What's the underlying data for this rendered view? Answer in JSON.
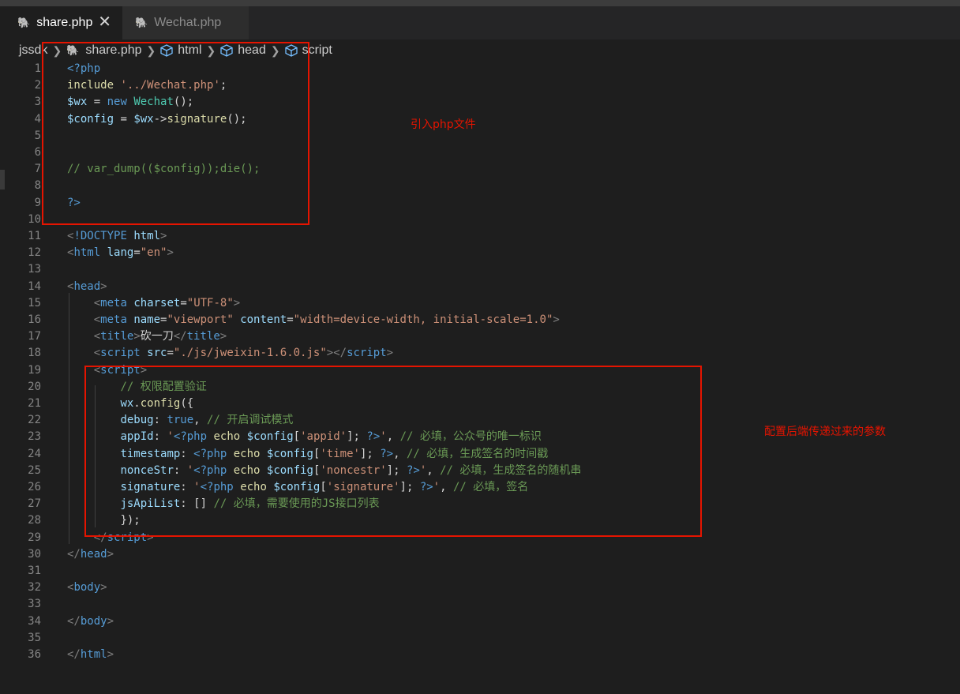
{
  "tabs": [
    {
      "label": "share.php",
      "active": true,
      "close": "✕"
    },
    {
      "label": "Wechat.php",
      "active": false
    }
  ],
  "breadcrumb": {
    "folder": "jssdk",
    "file": "share.php",
    "items": [
      "html",
      "head",
      "script"
    ]
  },
  "lines": [
    {
      "n": "1",
      "tokens": [
        [
          "tag",
          "<?php"
        ]
      ]
    },
    {
      "n": "2",
      "tokens": [
        [
          "fn",
          "include"
        ],
        [
          "ident",
          " "
        ],
        [
          "str",
          "'../Wechat.php'"
        ],
        [
          "ident",
          ";"
        ]
      ]
    },
    {
      "n": "3",
      "tokens": [
        [
          "var",
          "$wx"
        ],
        [
          "ident",
          " = "
        ],
        [
          "kw",
          "new"
        ],
        [
          "ident",
          " "
        ],
        [
          "cls",
          "Wechat"
        ],
        [
          "ident",
          "();"
        ]
      ]
    },
    {
      "n": "4",
      "tokens": [
        [
          "var",
          "$config"
        ],
        [
          "ident",
          " = "
        ],
        [
          "var",
          "$wx"
        ],
        [
          "ident",
          "->"
        ],
        [
          "fn",
          "signature"
        ],
        [
          "ident",
          "();"
        ]
      ]
    },
    {
      "n": "5",
      "tokens": []
    },
    {
      "n": "6",
      "tokens": []
    },
    {
      "n": "7",
      "tokens": [
        [
          "cm",
          "// var_dump(($config));die();"
        ]
      ]
    },
    {
      "n": "8",
      "tokens": []
    },
    {
      "n": "9",
      "tokens": [
        [
          "tag",
          "?>"
        ]
      ]
    },
    {
      "n": "10",
      "tokens": []
    },
    {
      "n": "11",
      "tokens": [
        [
          "punct",
          "<"
        ],
        [
          "tag",
          "!DOCTYPE"
        ],
        [
          "ident",
          " "
        ],
        [
          "var",
          "html"
        ],
        [
          "punct",
          ">"
        ]
      ]
    },
    {
      "n": "12",
      "tokens": [
        [
          "punct",
          "<"
        ],
        [
          "tag",
          "html"
        ],
        [
          "ident",
          " "
        ],
        [
          "var",
          "lang"
        ],
        [
          "ident",
          "="
        ],
        [
          "str",
          "\"en\""
        ],
        [
          "punct",
          ">"
        ]
      ]
    },
    {
      "n": "13",
      "tokens": []
    },
    {
      "n": "14",
      "tokens": [
        [
          "punct",
          "<"
        ],
        [
          "tag",
          "head"
        ],
        [
          "punct",
          ">"
        ]
      ]
    },
    {
      "n": "15",
      "tokens": [
        [
          "ident",
          "    "
        ],
        [
          "punct",
          "<"
        ],
        [
          "tag",
          "meta"
        ],
        [
          "ident",
          " "
        ],
        [
          "var",
          "charset"
        ],
        [
          "ident",
          "="
        ],
        [
          "str",
          "\"UTF-8\""
        ],
        [
          "punct",
          ">"
        ]
      ]
    },
    {
      "n": "16",
      "tokens": [
        [
          "ident",
          "    "
        ],
        [
          "punct",
          "<"
        ],
        [
          "tag",
          "meta"
        ],
        [
          "ident",
          " "
        ],
        [
          "var",
          "name"
        ],
        [
          "ident",
          "="
        ],
        [
          "str",
          "\"viewport\""
        ],
        [
          "ident",
          " "
        ],
        [
          "var",
          "content"
        ],
        [
          "ident",
          "="
        ],
        [
          "str",
          "\"width=device-width, initial-scale=1.0\""
        ],
        [
          "punct",
          ">"
        ]
      ]
    },
    {
      "n": "17",
      "tokens": [
        [
          "ident",
          "    "
        ],
        [
          "punct",
          "<"
        ],
        [
          "tag",
          "title"
        ],
        [
          "punct",
          ">"
        ],
        [
          "ident",
          "砍一刀"
        ],
        [
          "punct",
          "</"
        ],
        [
          "tag",
          "title"
        ],
        [
          "punct",
          ">"
        ]
      ]
    },
    {
      "n": "18",
      "tokens": [
        [
          "ident",
          "    "
        ],
        [
          "punct",
          "<"
        ],
        [
          "tag",
          "script"
        ],
        [
          "ident",
          " "
        ],
        [
          "var",
          "src"
        ],
        [
          "ident",
          "="
        ],
        [
          "str",
          "\"./js/jweixin-1.6.0.js\""
        ],
        [
          "punct",
          "></"
        ],
        [
          "tag",
          "script"
        ],
        [
          "punct",
          ">"
        ]
      ]
    },
    {
      "n": "19",
      "tokens": [
        [
          "ident",
          "    "
        ],
        [
          "punct",
          "<"
        ],
        [
          "tag",
          "script"
        ],
        [
          "punct",
          ">"
        ]
      ]
    },
    {
      "n": "20",
      "tokens": [
        [
          "ident",
          "        "
        ],
        [
          "cm",
          "// 权限配置验证"
        ]
      ]
    },
    {
      "n": "21",
      "tokens": [
        [
          "ident",
          "        "
        ],
        [
          "var",
          "wx"
        ],
        [
          "ident",
          "."
        ],
        [
          "fn",
          "config"
        ],
        [
          "ident",
          "({"
        ]
      ]
    },
    {
      "n": "22",
      "tokens": [
        [
          "ident",
          "        "
        ],
        [
          "var",
          "debug"
        ],
        [
          "ident",
          ": "
        ],
        [
          "kw",
          "true"
        ],
        [
          "ident",
          ", "
        ],
        [
          "cm",
          "// 开启调试模式"
        ]
      ]
    },
    {
      "n": "23",
      "tokens": [
        [
          "ident",
          "        "
        ],
        [
          "var",
          "appId"
        ],
        [
          "ident",
          ": "
        ],
        [
          "str",
          "'"
        ],
        [
          "tag",
          "<?php"
        ],
        [
          "ident",
          " "
        ],
        [
          "fn",
          "echo"
        ],
        [
          "ident",
          " "
        ],
        [
          "var",
          "$config"
        ],
        [
          "ident",
          "["
        ],
        [
          "str",
          "'appid'"
        ],
        [
          "ident",
          "]; "
        ],
        [
          "tag",
          "?>"
        ],
        [
          "str",
          "'"
        ],
        [
          "ident",
          ", "
        ],
        [
          "cm",
          "// 必填，公众号的唯一标识"
        ]
      ]
    },
    {
      "n": "24",
      "tokens": [
        [
          "ident",
          "        "
        ],
        [
          "var",
          "timestamp"
        ],
        [
          "ident",
          ": "
        ],
        [
          "tag",
          "<?php"
        ],
        [
          "ident",
          " "
        ],
        [
          "fn",
          "echo"
        ],
        [
          "ident",
          " "
        ],
        [
          "var",
          "$config"
        ],
        [
          "ident",
          "["
        ],
        [
          "str",
          "'time'"
        ],
        [
          "ident",
          "]; "
        ],
        [
          "tag",
          "?>"
        ],
        [
          "ident",
          ", "
        ],
        [
          "cm",
          "// 必填，生成签名的时间戳"
        ]
      ]
    },
    {
      "n": "25",
      "tokens": [
        [
          "ident",
          "        "
        ],
        [
          "var",
          "nonceStr"
        ],
        [
          "ident",
          ": "
        ],
        [
          "str",
          "'"
        ],
        [
          "tag",
          "<?php"
        ],
        [
          "ident",
          " "
        ],
        [
          "fn",
          "echo"
        ],
        [
          "ident",
          " "
        ],
        [
          "var",
          "$config"
        ],
        [
          "ident",
          "["
        ],
        [
          "str",
          "'noncestr'"
        ],
        [
          "ident",
          "]; "
        ],
        [
          "tag",
          "?>"
        ],
        [
          "str",
          "'"
        ],
        [
          "ident",
          ", "
        ],
        [
          "cm",
          "// 必填，生成签名的随机串"
        ]
      ]
    },
    {
      "n": "26",
      "tokens": [
        [
          "ident",
          "        "
        ],
        [
          "var",
          "signature"
        ],
        [
          "ident",
          ": "
        ],
        [
          "str",
          "'"
        ],
        [
          "tag",
          "<?php"
        ],
        [
          "ident",
          " "
        ],
        [
          "fn",
          "echo"
        ],
        [
          "ident",
          " "
        ],
        [
          "var",
          "$config"
        ],
        [
          "ident",
          "["
        ],
        [
          "str",
          "'signature'"
        ],
        [
          "ident",
          "]; "
        ],
        [
          "tag",
          "?>"
        ],
        [
          "str",
          "'"
        ],
        [
          "ident",
          ", "
        ],
        [
          "cm",
          "// 必填，签名"
        ]
      ]
    },
    {
      "n": "27",
      "tokens": [
        [
          "ident",
          "        "
        ],
        [
          "var",
          "jsApiList"
        ],
        [
          "ident",
          ": [] "
        ],
        [
          "cm",
          "// 必填，需要使用的JS接口列表"
        ]
      ]
    },
    {
      "n": "28",
      "tokens": [
        [
          "ident",
          "        "
        ],
        [
          "ident",
          "});"
        ]
      ]
    },
    {
      "n": "29",
      "tokens": [
        [
          "ident",
          "    "
        ],
        [
          "punct",
          "</"
        ],
        [
          "tag",
          "script"
        ],
        [
          "punct",
          ">"
        ]
      ]
    },
    {
      "n": "30",
      "tokens": [
        [
          "punct",
          "</"
        ],
        [
          "tag",
          "head"
        ],
        [
          "punct",
          ">"
        ]
      ]
    },
    {
      "n": "31",
      "tokens": []
    },
    {
      "n": "32",
      "tokens": [
        [
          "punct",
          "<"
        ],
        [
          "tag",
          "body"
        ],
        [
          "punct",
          ">"
        ]
      ]
    },
    {
      "n": "33",
      "tokens": []
    },
    {
      "n": "34",
      "tokens": [
        [
          "punct",
          "</"
        ],
        [
          "tag",
          "body"
        ],
        [
          "punct",
          ">"
        ]
      ]
    },
    {
      "n": "35",
      "tokens": []
    },
    {
      "n": "36",
      "tokens": [
        [
          "punct",
          "</"
        ],
        [
          "tag",
          "html"
        ],
        [
          "punct",
          ">"
        ]
      ]
    }
  ],
  "annotations": [
    {
      "text": "引入php文件"
    },
    {
      "text": "配置后端传递过来的参数"
    }
  ],
  "colors": {
    "annotation": "#e51400",
    "keyword": "#569cd6",
    "string": "#ce9178",
    "comment": "#6a9955",
    "variable": "#9cdcfe",
    "function": "#dcdcaa"
  }
}
